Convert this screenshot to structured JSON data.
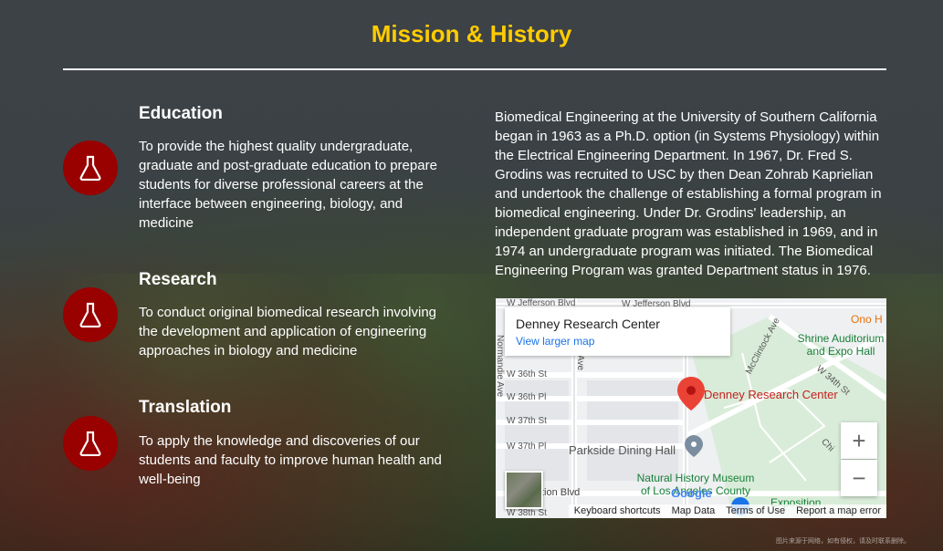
{
  "title": "Mission & History",
  "pillars": [
    {
      "title": "Education",
      "text": "To provide the highest quality undergraduate, graduate and post-graduate education to prepare students for diverse professional careers at the interface between engineering, biology, and medicine",
      "icon": "flask-icon"
    },
    {
      "title": "Research",
      "text": "To conduct original biomedical research involving the development and application of engineering approaches in biology and medicine",
      "icon": "flask-icon"
    },
    {
      "title": "Translation",
      "text": "To apply the knowledge and discoveries of our students and faculty to improve human health and well-being",
      "icon": "flask-icon"
    }
  ],
  "history": "Biomedical Engineering at the University of Southern California began in 1963 as a Ph.D. option (in Systems Physiology) within the Electrical Engineering Department. In 1967, Dr. Fred S. Grodins was recruited to USC by then Dean Zohrab Kaprielian and undertook the challenge of establishing a formal program in biomedical engineering. Under Dr. Grodins' leadership, an independent graduate program was established in 1969, and in 1974 an undergraduate program was initiated. The Biomedical Engineering Program was granted Department status in 1976.",
  "map": {
    "place_name": "Denney Research Center",
    "view_larger": "View larger map",
    "marker_label": "Denney Research Center",
    "streets": {
      "jefferson_1": "W Jefferson Blvd",
      "jefferson_2": "W Jefferson Blvd",
      "normandie": "Normandie Ave",
      "w36st": "W 36th St",
      "w36pl": "W 36th Pl",
      "w37st": "W 37th St",
      "w37pl": "W 37th Pl",
      "w38st": "W 38th St",
      "mcclintock": "McClintock Ave",
      "w34st": "W 34th St",
      "ave_short": "Ave",
      "exposition_blvd": "tion Blvd",
      "chi": "Chi"
    },
    "pois": {
      "parkside": "Parkside Dining Hall",
      "museum_line1": "Natural History Museum",
      "museum_line2": "of Los Angeles County",
      "shrine_line1": "Shrine Auditorium",
      "shrine_line2": "and Expo Hall",
      "ono": "Ono H",
      "exposition": "Exposition"
    },
    "google": "Google",
    "zoom_in": "+",
    "zoom_out": "−",
    "footer": [
      "Keyboard shortcuts",
      "Map Data",
      "Terms of Use",
      "Report a map error"
    ]
  },
  "watermark": "图片来源于网络，如有侵权，请及时联系删除。",
  "colors": {
    "accent": "#ffcc00",
    "icon_bg": "#990000",
    "map_link": "#1a73e8",
    "poi_green": "#188038",
    "marker_red": "#ea4335"
  }
}
